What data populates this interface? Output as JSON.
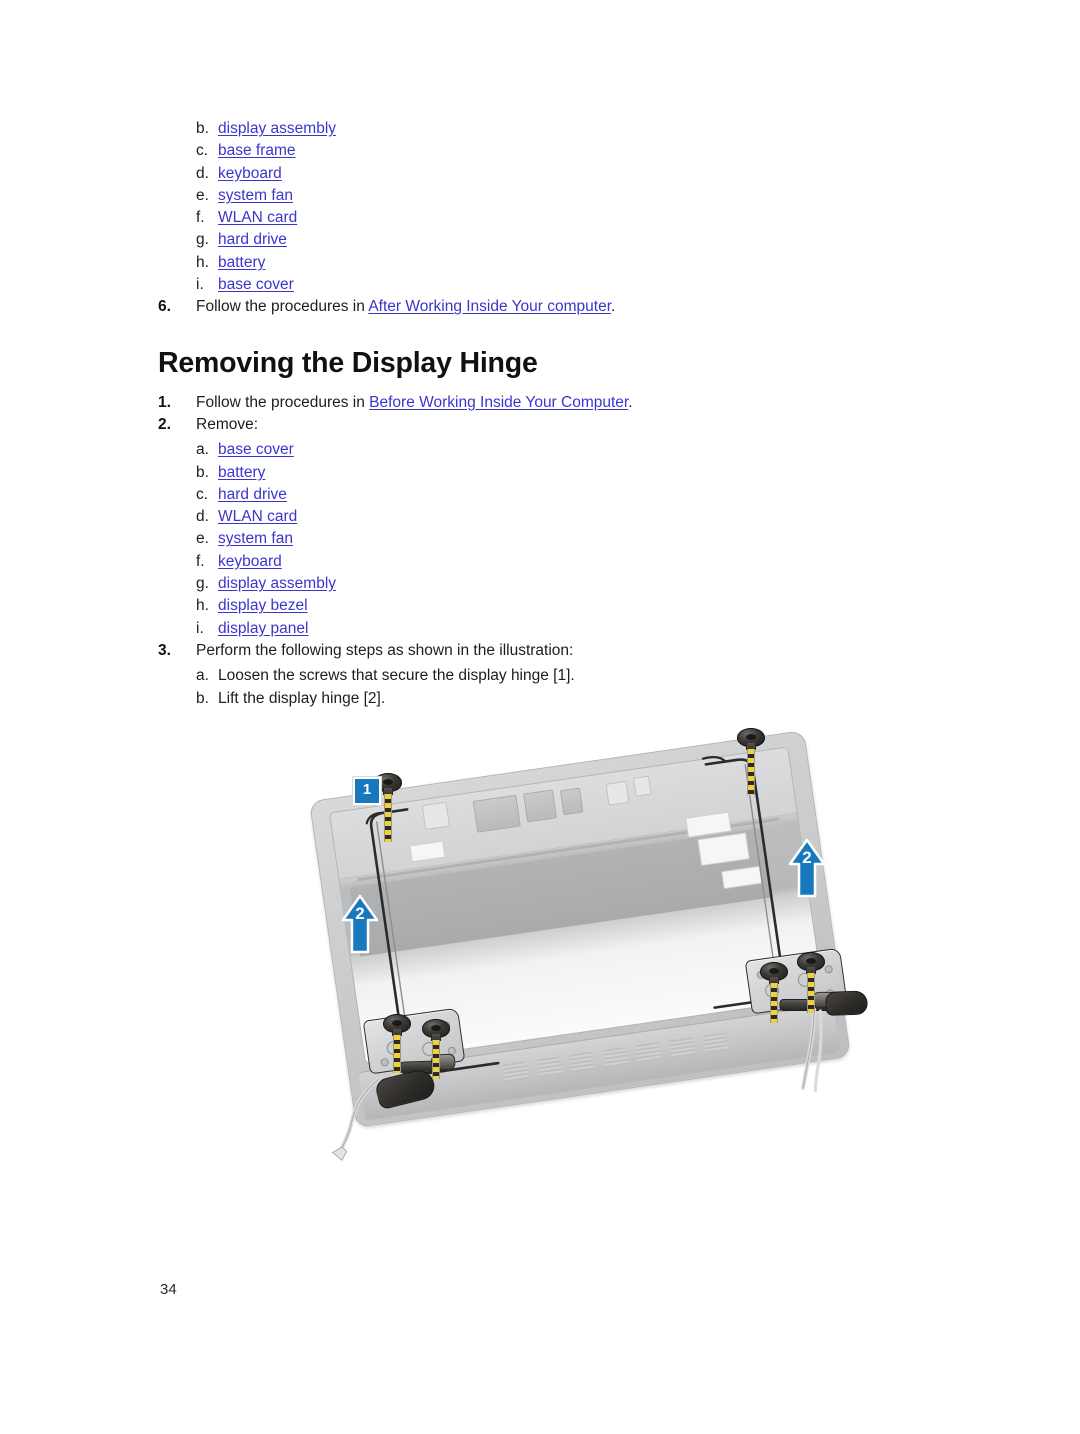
{
  "document": {
    "page_number": "34",
    "link_color": "#3b35cc"
  },
  "top_section": {
    "sub_items": [
      {
        "marker": "b.",
        "label": "display assembly",
        "link": true
      },
      {
        "marker": "c.",
        "label": "base frame",
        "link": true
      },
      {
        "marker": "d.",
        "label": "keyboard",
        "link": true
      },
      {
        "marker": "e.",
        "label": "system fan",
        "link": true
      },
      {
        "marker": "f.",
        "label": "WLAN card",
        "link": true
      },
      {
        "marker": "g.",
        "label": "hard drive",
        "link": true
      },
      {
        "marker": "h.",
        "label": "battery",
        "link": true
      },
      {
        "marker": "i.",
        "label": "base cover",
        "link": true
      }
    ],
    "step6": {
      "marker": "6.",
      "text_before": "Follow the procedures in ",
      "link_text": "After Working Inside Your computer",
      "text_after": "."
    }
  },
  "heading": "Removing the Display Hinge",
  "procedure": {
    "step1": {
      "marker": "1.",
      "text_before": "Follow the procedures in ",
      "link_text": "Before Working Inside Your Computer",
      "text_after": "."
    },
    "step2": {
      "marker": "2.",
      "text": "Remove:",
      "sub_items": [
        {
          "marker": "a.",
          "label": "base cover",
          "link": true
        },
        {
          "marker": "b.",
          "label": "battery",
          "link": true
        },
        {
          "marker": "c.",
          "label": "hard drive",
          "link": true
        },
        {
          "marker": "d.",
          "label": "WLAN card",
          "link": true
        },
        {
          "marker": "e.",
          "label": "system fan",
          "link": true
        },
        {
          "marker": "f.",
          "label": "keyboard",
          "link": true
        },
        {
          "marker": "g.",
          "label": "display assembly",
          "link": true
        },
        {
          "marker": "h.",
          "label": "display bezel",
          "link": true
        },
        {
          "marker": "i.",
          "label": "display panel",
          "link": true
        }
      ]
    },
    "step3": {
      "marker": "3.",
      "text": "Perform the following steps as shown in the illustration:",
      "sub_items": [
        {
          "marker": "a.",
          "label": "Loosen the screws that secure the display hinge [1].",
          "link": false
        },
        {
          "marker": "b.",
          "label": "Lift the display hinge [2].",
          "link": false
        }
      ]
    }
  },
  "illustration": {
    "alt": "Display back cover with hinges, captive screws loosened and hinge lifted",
    "callouts": [
      {
        "id": "callout-1",
        "label": "1",
        "style": "box",
        "color": "#1878be"
      },
      {
        "id": "callout-2-left",
        "label": "2",
        "style": "arrow",
        "color": "#1878be"
      },
      {
        "id": "callout-2-right",
        "label": "2",
        "style": "arrow",
        "color": "#1878be"
      }
    ],
    "screw_count": "6"
  }
}
